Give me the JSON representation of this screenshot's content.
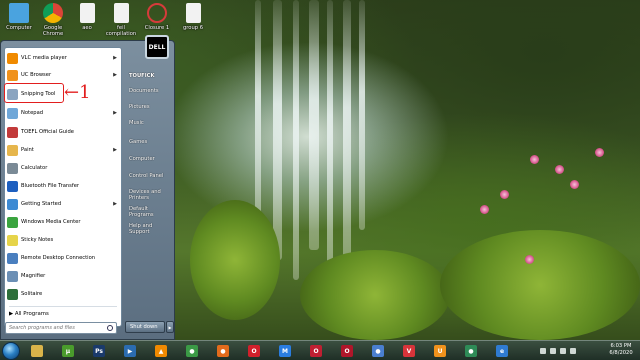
{
  "desktop": {
    "icons": [
      {
        "label": "Computer",
        "color": "#4aa3df"
      },
      {
        "label": "Google Chrome",
        "color": "#e8b52c"
      },
      {
        "label": "aeo",
        "color": "#f2f2f2"
      },
      {
        "label": "feil compilation",
        "color": "#f2f2f2"
      },
      {
        "label": "Closure 1",
        "color": "#d63b3b"
      },
      {
        "label": "group 6",
        "color": "#f2f2f2"
      }
    ]
  },
  "start_menu": {
    "programs": [
      {
        "label": "VLC media player",
        "icon": "vlc-icon",
        "color": "#f08a00",
        "arrow": true
      },
      {
        "label": "UC Browser",
        "icon": "uc-browser-icon",
        "color": "#f0921c",
        "arrow": true
      },
      {
        "label": "Snipping Tool",
        "icon": "scissors-icon",
        "color": "#8aa4c0",
        "arrow": false
      },
      {
        "label": "Notepad",
        "icon": "notepad-icon",
        "color": "#6fa7d8",
        "arrow": true
      },
      {
        "label": "TOEFL Official Guide",
        "icon": "book-icon",
        "color": "#c23a3a",
        "arrow": false
      },
      {
        "label": "Paint",
        "icon": "paint-icon",
        "color": "#e6b64c",
        "arrow": true
      },
      {
        "label": "Calculator",
        "icon": "calculator-icon",
        "color": "#7a8a96",
        "arrow": false
      },
      {
        "label": "Bluetooth File Transfer",
        "icon": "bluetooth-icon",
        "color": "#1d5fbf",
        "arrow": false
      },
      {
        "label": "Getting Started",
        "icon": "getting-started-icon",
        "color": "#3d8ad3",
        "arrow": true
      },
      {
        "label": "Windows Media Center",
        "icon": "media-center-icon",
        "color": "#3aa43f",
        "arrow": false
      },
      {
        "label": "Sticky Notes",
        "icon": "sticky-notes-icon",
        "color": "#e6d44a",
        "arrow": false
      },
      {
        "label": "Remote Desktop Connection",
        "icon": "remote-desktop-icon",
        "color": "#4a7fbf",
        "arrow": false
      },
      {
        "label": "Magnifier",
        "icon": "magnifier-icon",
        "color": "#6b8fb5",
        "arrow": false
      },
      {
        "label": "Solitaire",
        "icon": "solitaire-icon",
        "color": "#2d6f3a",
        "arrow": false
      }
    ],
    "all_programs": "All Programs",
    "search_placeholder": "Search programs and files",
    "user_tile": "DELL",
    "right_items": [
      "TOUFICK",
      "Documents",
      "Pictures",
      "Music",
      "Games",
      "Computer",
      "Control Panel",
      "Devices and Printers",
      "Default Programs",
      "Help and Support"
    ],
    "shutdown_label": "Shut down",
    "annotation": "1",
    "highlight_color": "#e21e1e"
  },
  "taskbar": {
    "items": [
      {
        "icon": "explorer-icon",
        "color": "#d9b44a",
        "glyph": ""
      },
      {
        "icon": "utorrent-icon",
        "color": "#4a9c2c",
        "glyph": "µ"
      },
      {
        "icon": "photoshop-icon",
        "color": "#1a3a6b",
        "glyph": "Ps"
      },
      {
        "icon": "media-player-icon",
        "color": "#2b6cb0",
        "glyph": "▶"
      },
      {
        "icon": "vlc-icon",
        "color": "#f08a00",
        "glyph": "▲"
      },
      {
        "icon": "chrome-icon",
        "color": "#3b9a46",
        "glyph": "●"
      },
      {
        "icon": "firefox-icon",
        "color": "#e36b1c",
        "glyph": "●"
      },
      {
        "icon": "opera-icon",
        "color": "#d1202b",
        "glyph": "O"
      },
      {
        "icon": "maxthon-icon",
        "color": "#2a7de1",
        "glyph": "M"
      },
      {
        "icon": "opera-gx-icon",
        "color": "#c01f32",
        "glyph": "O"
      },
      {
        "icon": "opera-red-icon",
        "color": "#b0162a",
        "glyph": "O"
      },
      {
        "icon": "chromium-icon",
        "color": "#4a7fd0",
        "glyph": "●"
      },
      {
        "icon": "vivaldi-icon",
        "color": "#d8343a",
        "glyph": "V"
      },
      {
        "icon": "uc-browser-icon",
        "color": "#f0921c",
        "glyph": "U"
      },
      {
        "icon": "chrome-beta-icon",
        "color": "#2e8b57",
        "glyph": "●"
      },
      {
        "icon": "ie-icon",
        "color": "#2f7bd1",
        "glyph": "e"
      }
    ],
    "clock_time": "6:03 PM",
    "clock_date": "6/8/2020"
  }
}
